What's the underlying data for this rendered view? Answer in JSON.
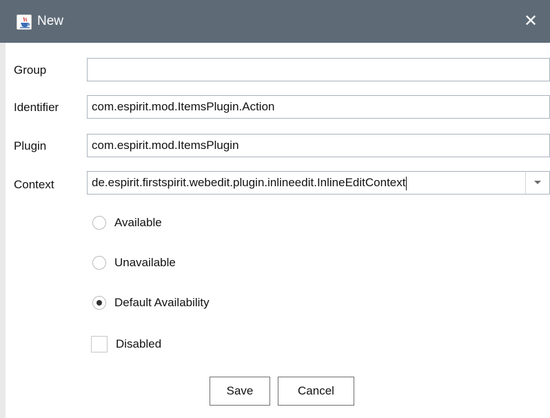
{
  "window": {
    "title": "New",
    "icon": "java-cup-icon",
    "close_glyph": "✕"
  },
  "form": {
    "group": {
      "label": "Group",
      "value": ""
    },
    "identifier": {
      "label": "Identifier",
      "value": "com.espirit.mod.ItemsPlugin.Action"
    },
    "plugin": {
      "label": "Plugin",
      "value": "com.espirit.mod.ItemsPlugin"
    },
    "context": {
      "label": "Context",
      "value": "de.espirit.firstspirit.webedit.plugin.inlineedit.InlineEditContext"
    }
  },
  "availability": {
    "options": [
      {
        "label": "Available",
        "selected": false
      },
      {
        "label": "Unavailable",
        "selected": false
      },
      {
        "label": "Default Availability",
        "selected": true
      }
    ]
  },
  "disabled": {
    "label": "Disabled",
    "checked": false
  },
  "buttons": {
    "save": "Save",
    "cancel": "Cancel"
  },
  "colors": {
    "titlebar": "#5e6b77",
    "field_border": "#aab2bd",
    "button_border": "#6c6c6c"
  }
}
